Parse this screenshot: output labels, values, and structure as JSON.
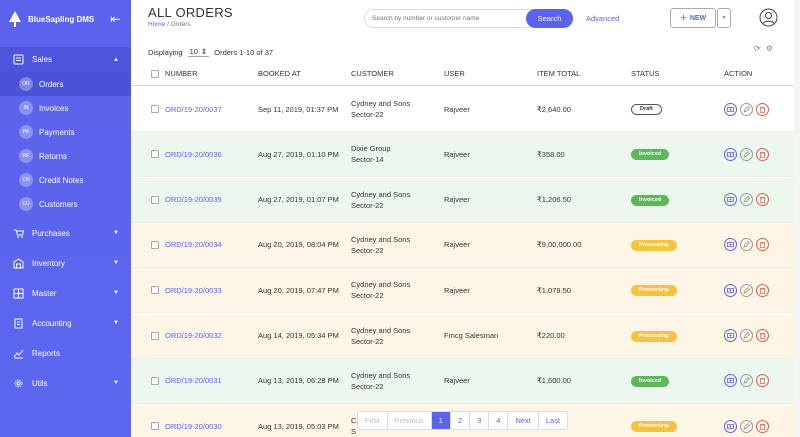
{
  "app": {
    "name": "BlueSapling DMS"
  },
  "sidebar": {
    "sales": {
      "label": "Sales",
      "items": [
        {
          "abbr": "OR",
          "label": "Orders"
        },
        {
          "abbr": "IN",
          "label": "Invoices"
        },
        {
          "abbr": "PA",
          "label": "Payments"
        },
        {
          "abbr": "RE",
          "label": "Returns"
        },
        {
          "abbr": "CN",
          "label": "Credit Notes"
        },
        {
          "abbr": "CU",
          "label": "Customers"
        }
      ]
    },
    "menu": [
      {
        "label": "Purchases"
      },
      {
        "label": "Inventory"
      },
      {
        "label": "Master"
      },
      {
        "label": "Accounting"
      },
      {
        "label": "Reports"
      },
      {
        "label": "Utils"
      }
    ]
  },
  "header": {
    "title": "ALL ORDERS",
    "breadcrumb": {
      "home": "Home",
      "sep": "/",
      "current": "Orders"
    },
    "search_placeholder": "Search by number or customer name",
    "search_button": "Search",
    "advanced": "Advanced",
    "new_button": "NEW"
  },
  "display": {
    "prefix": "Displaying",
    "per_page": "10",
    "range": "Orders 1-10 of 37"
  },
  "table": {
    "headers": [
      "NUMBER",
      "BOOKED AT",
      "CUSTOMER",
      "USER",
      "ITEM TOTAL",
      "STATUS",
      "ACTION"
    ],
    "rows": [
      {
        "number": "ORD/19-20/0037",
        "booked": "Sep 11, 2019, 01:37 PM",
        "cust1": "Cydney and Sons",
        "cust2": "Sector-22",
        "user": "Rajveer",
        "total": "₹2,640.00",
        "status": "Draft"
      },
      {
        "number": "ORD/19-20/0036",
        "booked": "Aug 27, 2019, 01:10 PM",
        "cust1": "Dixie Group",
        "cust2": "Sector-14",
        "user": "Rajveer",
        "total": "₹358.00",
        "status": "Invoiced"
      },
      {
        "number": "ORD/19-20/0035",
        "booked": "Aug 27, 2019, 01:07 PM",
        "cust1": "Cydney and Sons",
        "cust2": "Sector-22",
        "user": "Rajveer",
        "total": "₹1,206.50",
        "status": "Invoiced"
      },
      {
        "number": "ORD/19-20/0034",
        "booked": "Aug 20, 2019, 08:04 PM",
        "cust1": "Cydney and Sons",
        "cust2": "Sector-22",
        "user": "Rajveer",
        "total": "₹9,00,000.00",
        "status": "Processing"
      },
      {
        "number": "ORD/19-20/0033",
        "booked": "Aug 20, 2019, 07:47 PM",
        "cust1": "Cydney and Sons",
        "cust2": "Sector-22",
        "user": "Rajveer",
        "total": "₹1,079.50",
        "status": "Processing"
      },
      {
        "number": "ORD/19-20/0032",
        "booked": "Aug 14, 2019, 05:34 PM",
        "cust1": "Cydney and Sons",
        "cust2": "Sector-22",
        "user": "Fmcg Salesman",
        "total": "₹220.00",
        "status": "Processing"
      },
      {
        "number": "ORD/19-20/0031",
        "booked": "Aug 13, 2019, 06:28 PM",
        "cust1": "Cydney and Sons",
        "cust2": "Sector-22",
        "user": "Rajveer",
        "total": "₹1,600.00",
        "status": "Invoiced"
      },
      {
        "number": "ORD/19-20/0030",
        "booked": "Aug 13, 2019, 05:03 PM",
        "cust1": "C",
        "cust2": "S",
        "user": "",
        "total": "",
        "status": "Processing"
      }
    ]
  },
  "pager": [
    "First",
    "Previous",
    "1",
    "2",
    "3",
    "4",
    "Next",
    "Last"
  ],
  "colors": {
    "accent": "#5b63ec",
    "invoiced": "#5cb85c",
    "processing": "#f5c242",
    "danger": "#e05b4c"
  }
}
